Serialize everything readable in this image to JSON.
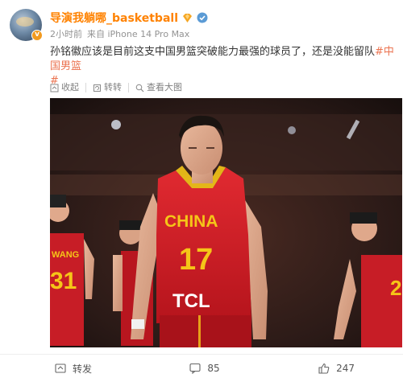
{
  "post": {
    "username": "导演我躺哪_basketball",
    "time": "2小时前",
    "source": "来自 iPhone 14 Pro Max",
    "text_main": "孙铭徽应该是目前这支中国男篮突破能力最强的球员了，还是没能留队",
    "hashtag_a": "#中国男篮",
    "hashtag_b": "#"
  },
  "toolbar": {
    "collect": "收起",
    "repost": "转转",
    "view_large": "查看大图"
  },
  "photo": {
    "jersey_text": "CHINA",
    "jersey_number": "17",
    "sponsor": "TCL",
    "left_player_number": "31",
    "left_player_name": "WANG"
  },
  "footer": {
    "repost_label": "转发",
    "comment_count": "85",
    "like_count": "247"
  },
  "colors": {
    "username": "#ff8200",
    "hashtag": "#eb7350",
    "jersey_red": "#d4202a",
    "jersey_gold": "#f5c518"
  },
  "icons": {
    "level": "level-badge-icon",
    "verify": "verified-icon",
    "collect": "collapse-icon",
    "repost": "repost-icon",
    "view": "magnify-icon",
    "comment": "comment-icon",
    "like": "thumbs-up-icon"
  }
}
